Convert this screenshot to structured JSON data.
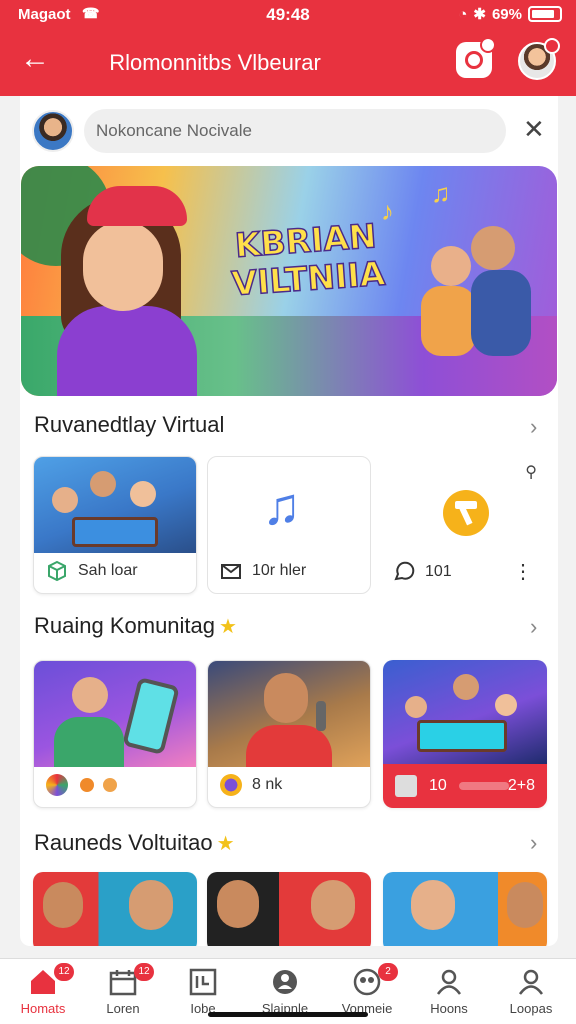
{
  "status": {
    "carrier": "Magaot",
    "time": "49:48",
    "battery": "69%"
  },
  "header": {
    "title": "Rlomonnitbs Vlbeurar",
    "back_icon": "back-arrow-icon",
    "camera_icon": "camera-icon"
  },
  "search": {
    "placeholder": "Nokoncane Nocivale"
  },
  "hero": {
    "line1": "KBRIAN",
    "line2": "VILTNIIA"
  },
  "sections": [
    {
      "title": "Ruvanedtlay Virtual",
      "star": false
    },
    {
      "title": "Ruaing Komunitag",
      "star": true
    },
    {
      "title": "Rauneds Voltuitao",
      "star": true
    }
  ],
  "row1": [
    {
      "label": "Sah loar",
      "icon": "cube-icon"
    },
    {
      "label": "10r hler",
      "icon": "mail-icon"
    },
    {
      "label": "101",
      "icon": "chat-icon"
    }
  ],
  "row2": [
    {
      "label": "",
      "icon": "orbs-icon"
    },
    {
      "label": "8 nk",
      "icon": "orb-icon"
    },
    {
      "label": "10",
      "extra": "2+8",
      "icon": "chest-icon"
    }
  ],
  "nav": [
    {
      "label": "Homats",
      "icon": "home-icon",
      "badge": "12",
      "active": true
    },
    {
      "label": "Loren",
      "icon": "calendar-icon",
      "badge": "12",
      "active": false
    },
    {
      "label": "Iobe",
      "icon": "gallery-icon",
      "badge": "",
      "active": false
    },
    {
      "label": "Slaipnle",
      "icon": "people-icon",
      "badge": "",
      "active": false
    },
    {
      "label": "Vonmeie",
      "icon": "group-icon",
      "badge": "2",
      "active": false
    },
    {
      "label": "Hoons",
      "icon": "profile-icon",
      "badge": "",
      "active": false
    },
    {
      "label": "Loopas",
      "icon": "user-icon",
      "badge": "",
      "active": false
    }
  ],
  "colors": {
    "brand": "#e8323f",
    "star": "#f2c21a"
  }
}
